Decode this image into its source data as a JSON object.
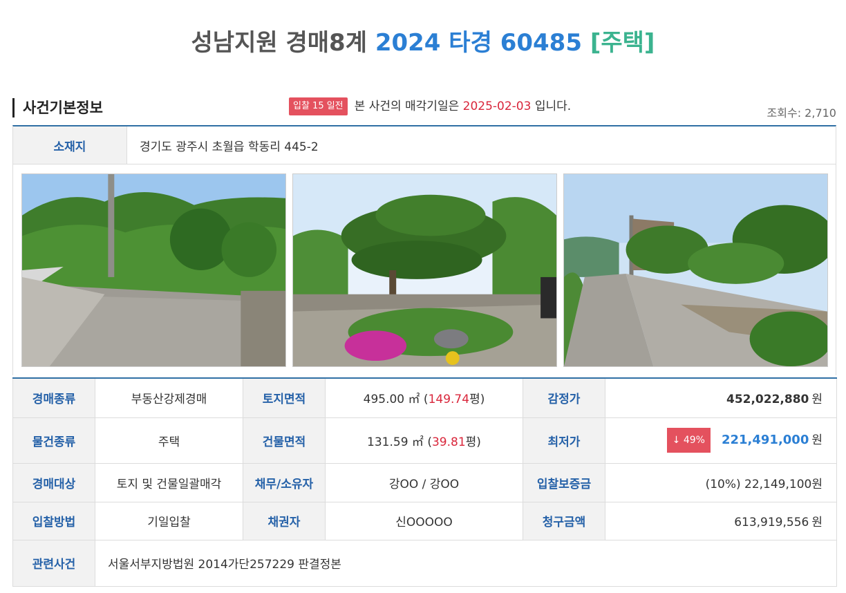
{
  "header": {
    "court": "성남지원 경매8계",
    "case_no": "2024 타경 60485",
    "type": "[주택]"
  },
  "section": {
    "title": "사건기본정보",
    "dday_badge": "입찰 15 일전",
    "notice_prefix": "본 사건의 매각기일은",
    "sale_date": "2025-02-03",
    "notice_suffix": "입니다.",
    "views": "조회수: 2,710"
  },
  "address": {
    "label": "소재지",
    "value": "경기도 광주시 초월읍 학동리 445-2"
  },
  "photos": [
    "photo-1",
    "photo-2",
    "photo-3"
  ],
  "info": {
    "auction_type": {
      "label": "경매종류",
      "value": "부동산강제경매"
    },
    "land_area": {
      "label": "토지면적",
      "sqm": "495.00 ㎡ (",
      "pyeong": "149.74",
      "pyeong_unit": "평)"
    },
    "appraisal": {
      "label": "감정가",
      "value": "452,022,880",
      "unit": "원"
    },
    "item_type": {
      "label": "물건종류",
      "value": "주택"
    },
    "building_area": {
      "label": "건물면적",
      "sqm": "131.59 ㎡ (",
      "pyeong": "39.81",
      "pyeong_unit": "평)"
    },
    "min_price": {
      "label": "최저가",
      "drop": "↓ 49%",
      "value": "221,491,000",
      "unit": "원"
    },
    "target": {
      "label": "경매대상",
      "value": "토지 및 건물일괄매각"
    },
    "debtor_owner": {
      "label": "채무/소유자",
      "value": "강OO / 강OO"
    },
    "deposit": {
      "label": "입찰보증금",
      "value": "(10%) 22,149,100원"
    },
    "bid_method": {
      "label": "입찰방법",
      "value": "기일입찰"
    },
    "creditor": {
      "label": "채권자",
      "value": "신OOOOO"
    },
    "claim": {
      "label": "청구금액",
      "value": "613,919,556",
      "unit": "원"
    },
    "related": {
      "label": "관련사건",
      "value": "서울서부지방법원 2014가단257229 판결정본"
    }
  },
  "colors": {
    "case_blue": "#2b7fd4",
    "type_green": "#3bb38f",
    "label_blue": "#2561a8",
    "accent_red": "#d9263b",
    "badge_red": "#e4515e"
  }
}
